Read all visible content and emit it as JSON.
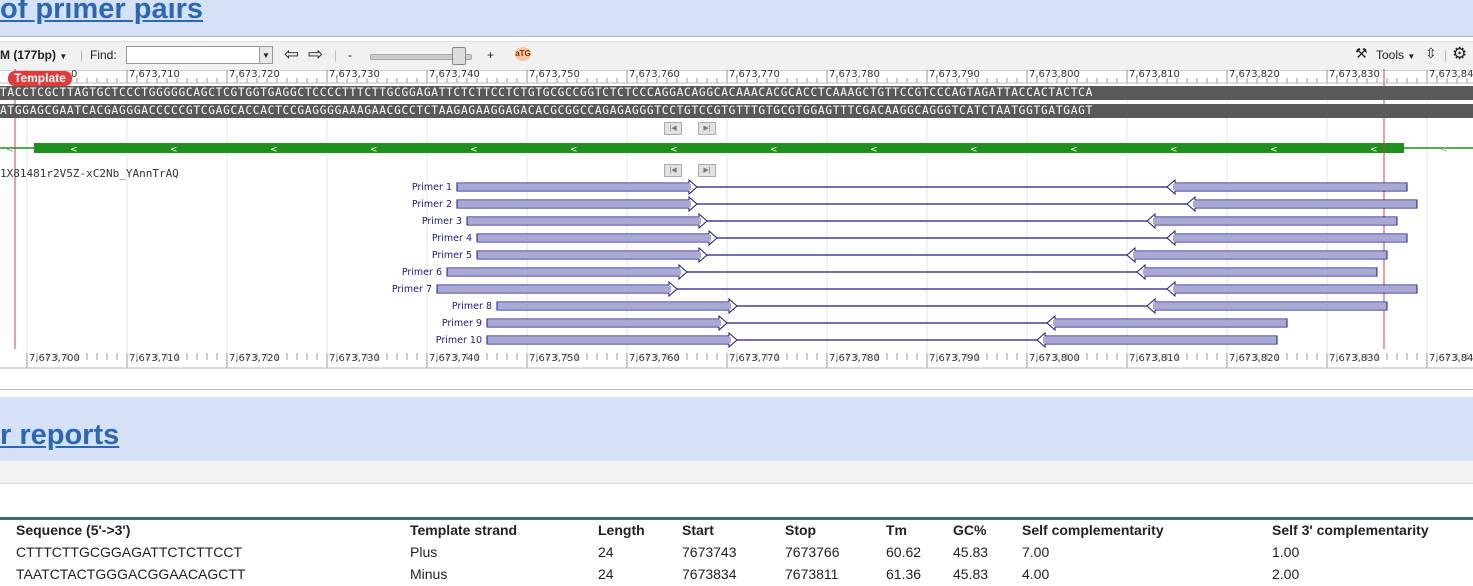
{
  "sections": {
    "primer_pairs_heading": "of primer pairs",
    "primer_reports_heading": "r reports"
  },
  "toolbar": {
    "range_label": "M (177bp)",
    "find_label": "Find:",
    "find_value": "",
    "zoom_minus": "-",
    "zoom_plus": "+",
    "tools_label": "Tools"
  },
  "template_badge": "Template",
  "ruler_top": [
    "0",
    "7,673,710",
    "7,673,720",
    "7,673,730",
    "7,673,740",
    "7,673,750",
    "7,673,760",
    "7,673,770",
    "7,673,780",
    "7,673,790",
    "7,673,800",
    "7,673,810",
    "7,673,820",
    "7,673,830",
    "7,673,84"
  ],
  "ruler_bottom": [
    "7,673,700",
    "7,673,710",
    "7,673,720",
    "7,673,730",
    "7,673,740",
    "7,673,750",
    "7,673,760",
    "7,673,770",
    "7,673,780",
    "7,673,790",
    "7,673,800",
    "7,673,810",
    "7,673,820",
    "7,673,830",
    "7,673,84"
  ],
  "sequence_plus": "TACCTCGCTTAGTGCTCCCTGGGGGCAGCTCGTGGTGAGGCTCCCCTTTCTTGCGGAGATTCTCTTCCTCTGTGCGCCGGTCTCTCCCAGGACAGGCACAAACACGCACCTCAAAGCTGTTCCGTCCCAGTAGATTACCACTACTCA",
  "sequence_minus": "ATGGAGCGAATCACGAGGGACCCCCGTCGAGCACCACTCCGAGGGGAAAGAACGCCTCTAAGAGAAGGAGACACGCGGCCAGAGAGGGTCCTGTCCGTGTTTGTGCGTGGAGTTTCGACAAGGCAGGGTCATCTAATGGTGATGAGT",
  "track_label": "1X81481r2V5Z-xC2Nb_YAnnTrAQ",
  "primers": [
    {
      "label": "Primer 1",
      "f_start": 7673743,
      "f_stop": 7673766,
      "r_start": 7673814,
      "r_stop": 7673837
    },
    {
      "label": "Primer 2",
      "f_start": 7673743,
      "f_stop": 7673766,
      "r_start": 7673816,
      "r_stop": 7673838
    },
    {
      "label": "Primer 3",
      "f_start": 7673744,
      "f_stop": 7673767,
      "r_start": 7673812,
      "r_stop": 7673836
    },
    {
      "label": "Primer 4",
      "f_start": 7673745,
      "f_stop": 7673768,
      "r_start": 7673814,
      "r_stop": 7673837
    },
    {
      "label": "Primer 5",
      "f_start": 7673745,
      "f_stop": 7673767,
      "r_start": 7673810,
      "r_stop": 7673835
    },
    {
      "label": "Primer 6",
      "f_start": 7673742,
      "f_stop": 7673765,
      "r_start": 7673811,
      "r_stop": 7673834
    },
    {
      "label": "Primer 7",
      "f_start": 7673741,
      "f_stop": 7673764,
      "r_start": 7673814,
      "r_stop": 7673838
    },
    {
      "label": "Primer 8",
      "f_start": 7673747,
      "f_stop": 7673770,
      "r_start": 7673812,
      "r_stop": 7673835
    },
    {
      "label": "Primer 9",
      "f_start": 7673746,
      "f_stop": 7673769,
      "r_start": 7673802,
      "r_stop": 7673825
    },
    {
      "label": "Primer 10",
      "f_start": 7673746,
      "f_stop": 7673770,
      "r_start": 7673801,
      "r_stop": 7673824
    }
  ],
  "report": {
    "headers": [
      "Sequence (5'->3')",
      "Template strand",
      "Length",
      "Start",
      "Stop",
      "Tm",
      "GC%",
      "Self complementarity",
      "Self 3' complementarity"
    ],
    "rows": [
      [
        "CTTTCTTGCGGAGATTCTCTTCCT",
        "Plus",
        "24",
        "7673743",
        "7673766",
        "60.62",
        "45.83",
        "7.00",
        "1.00"
      ],
      [
        "TAATCTACTGGGACGGAACAGCTT",
        "Minus",
        "24",
        "7673834",
        "7673811",
        "61.36",
        "45.83",
        "4.00",
        "2.00"
      ]
    ]
  },
  "colors": {
    "primer_blue": "#1a1a8c",
    "gene_green": "#1f8f1f",
    "marker_red": "#e23b3b",
    "heading_blue": "#2b67b5",
    "band_blue": "#d5e1f5"
  }
}
